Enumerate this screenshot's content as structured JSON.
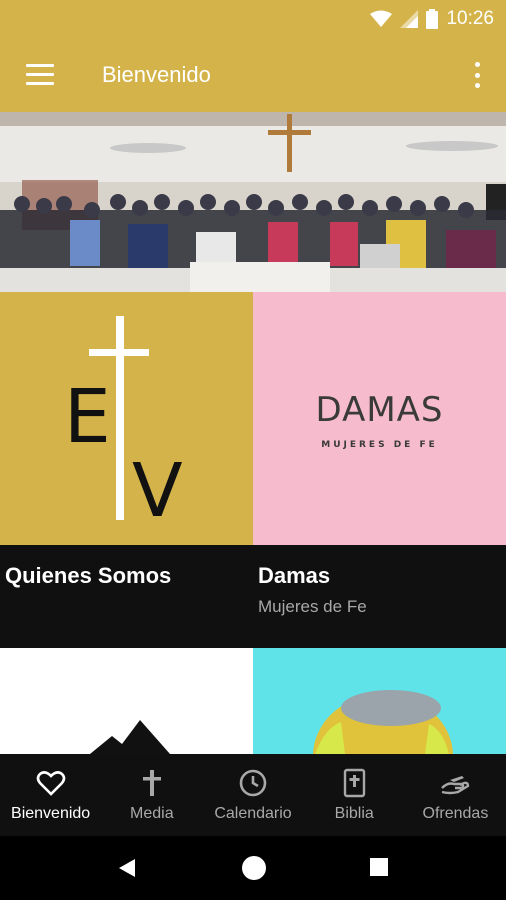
{
  "status_bar": {
    "time": "10:26"
  },
  "app_bar": {
    "title": "Bienvenido",
    "menu_icon": "hamburger-menu-icon",
    "more_icon": "more-vert-icon"
  },
  "hero": {
    "image": "church-congregation-group-photo"
  },
  "tiles": [
    {
      "logo": "EV",
      "title": "Quienes Somos",
      "subtitle": ""
    },
    {
      "logo": "DAMAS",
      "logo_sub": "MUJERES DE FE",
      "title": "Damas",
      "subtitle": "Mujeres de Fe"
    }
  ],
  "bottom_nav": [
    {
      "label": "Bienvenido",
      "icon": "heart-icon",
      "active": true
    },
    {
      "label": "Media",
      "icon": "cross-icon",
      "active": false
    },
    {
      "label": "Calendario",
      "icon": "clock-icon",
      "active": false
    },
    {
      "label": "Biblia",
      "icon": "bible-icon",
      "active": false
    },
    {
      "label": "Ofrendas",
      "icon": "offering-hand-icon",
      "active": false
    }
  ],
  "colors": {
    "accent": "#d4b44a",
    "pink": "#f6bccd",
    "cyan": "#5fe3e8",
    "dark": "#101010"
  }
}
